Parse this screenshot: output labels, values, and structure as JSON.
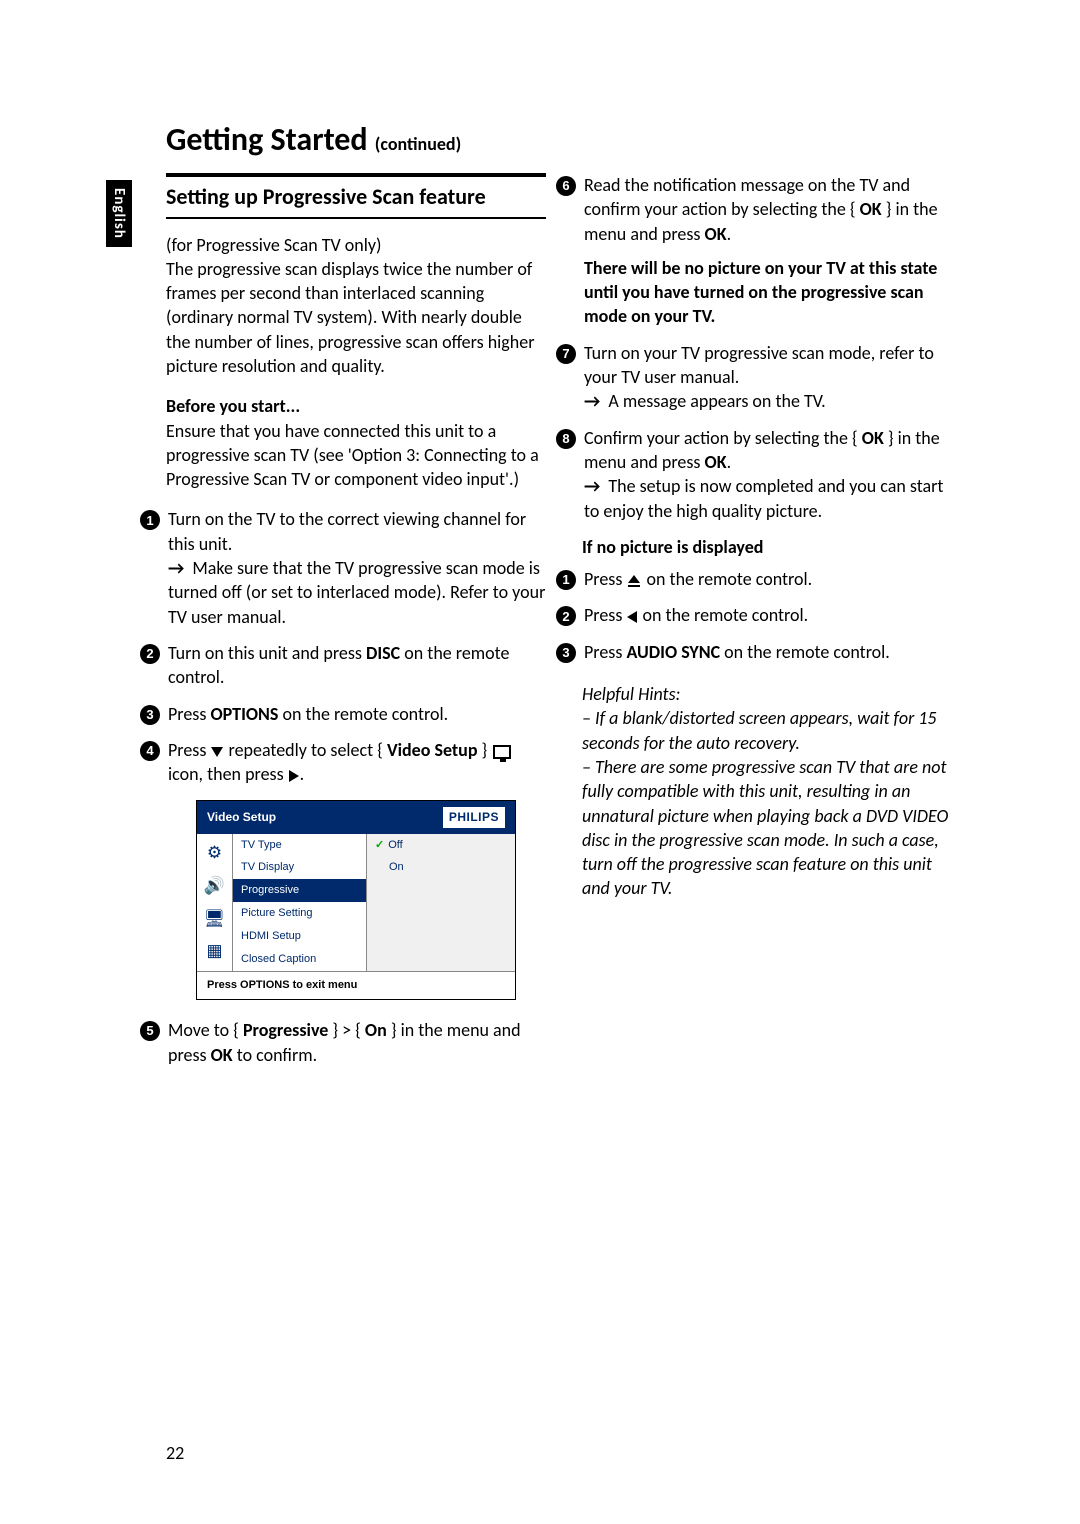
{
  "language_tab": "English",
  "page_number": "22",
  "title": {
    "main": "Getting Started",
    "suffix": "(continued)"
  },
  "section_heading": "Setting up Progressive Scan feature",
  "intro_note": "(for Progressive Scan TV only)",
  "intro_text": "The progressive scan displays twice the number of frames per second than interlaced scanning (ordinary normal TV system). With nearly double the number of lines, progressive scan offers higher picture resolution and quality.",
  "before_heading": "Before you start...",
  "before_text": "Ensure that you have connected this unit to a progressive scan TV (see 'Option 3: Connecting to a Progressive Scan TV or component video input'.)",
  "step1_a": "Turn on the TV to the correct viewing channel for this unit.",
  "step1_b": "Make sure that the TV progressive scan mode is turned off (or set to interlaced mode). Refer to your TV user manual.",
  "step2_pre": "Turn on this unit and press ",
  "step2_bold": "DISC",
  "step2_post": " on the remote control.",
  "step3_pre": "Press ",
  "step3_bold": "OPTIONS",
  "step3_post": " on the remote control.",
  "step4_pre": "Press ",
  "step4_mid": " repeatedly to select { ",
  "step4_bold": "Video Setup",
  "step4_mid2": " } ",
  "step4_post": " icon, then press ",
  "step5_pre": "Move to { ",
  "step5_b1": "Progressive",
  "step5_mid": " } > { ",
  "step5_b2": "On",
  "step5_mid2": " } in the menu and press ",
  "step5_b3": "OK",
  "step5_post": " to confirm.",
  "step6_a": "Read the notification message on the TV and confirm your action by selecting the { ",
  "step6_b1": "OK",
  "step6_b": " } in the menu and press ",
  "step6_b2": "OK",
  "step6_c": ".",
  "warn_text": "There will be no picture on your TV at this state until you have turned on the progressive scan mode on your TV.",
  "step7_a": "Turn on your TV progressive scan mode, refer to your TV user manual.",
  "step7_b": "A message appears on the TV.",
  "step8_a": "Confirm your action by selecting the { ",
  "step8_b1": "OK",
  "step8_b": " } in the menu and press ",
  "step8_b2": "OK",
  "step8_c": ".",
  "step8_d": "The setup is now completed and you can start to enjoy the high quality picture.",
  "nopic_heading": "If no picture is displayed",
  "np1_pre": "Press ",
  "np1_post": " on the remote control.",
  "np2_pre": "Press ",
  "np2_post": " on the remote control.",
  "np3_pre": "Press ",
  "np3_bold": "AUDIO SYNC",
  "np3_post": " on the remote control.",
  "hints_title": "Helpful Hints:",
  "hints_1": "– If a blank/distorted screen appears, wait for 15 seconds for the auto recovery.",
  "hints_2": "– There are some progressive scan TV that are not fully compatible with this unit, resulting in an unnatural picture when playing back a DVD VIDEO disc in the progressive scan mode. In such a case, turn off the progressive scan feature on this unit and your TV.",
  "menu": {
    "title": "Video Setup",
    "brand": "PHILIPS",
    "items": [
      "TV Type",
      "TV Display",
      "Progressive",
      "Picture Setting",
      "HDMI Setup",
      "Closed Caption"
    ],
    "selected_index": 2,
    "options": [
      "Off",
      "On"
    ],
    "footer": "Press OPTIONS to exit menu"
  }
}
